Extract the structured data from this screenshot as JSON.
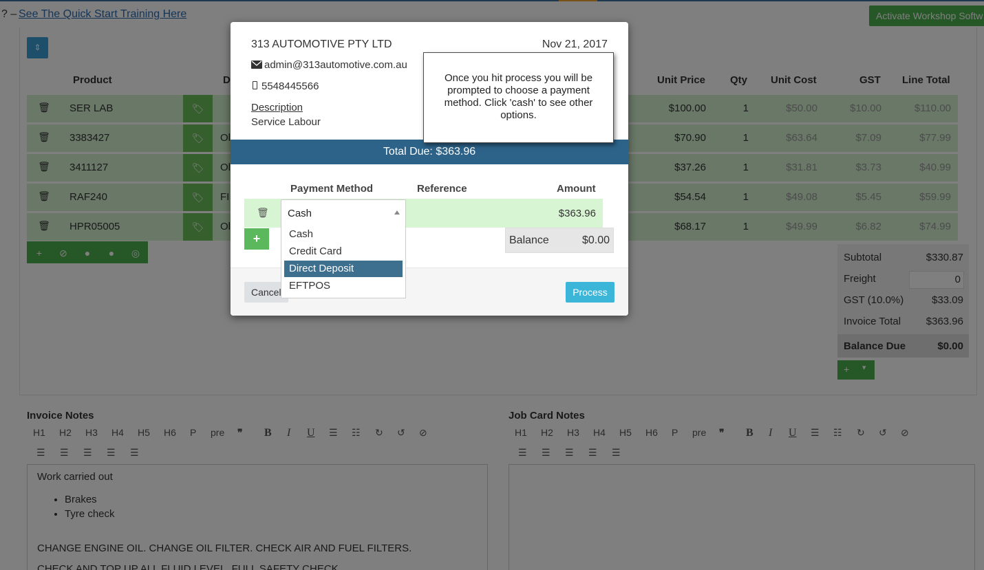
{
  "topbar": {
    "prefix": "? –",
    "training_link": "See The Quick Start Training Here",
    "activate_button": "Activate Workshop Softw"
  },
  "table": {
    "headers": [
      "Product",
      "D",
      "Unit Price",
      "Qty",
      "Unit Cost",
      "GST",
      "Line Total"
    ],
    "rows": [
      {
        "code": "SER LAB",
        "desc": "",
        "unit_price": "$100.00",
        "qty": "1",
        "unit_cost": "$50.00",
        "gst": "$10.00",
        "line_total": "$110.00"
      },
      {
        "code": "3383427",
        "desc": "Ol",
        "unit_price": "$70.90",
        "qty": "1",
        "unit_cost": "$63.64",
        "gst": "$7.09",
        "line_total": "$77.99"
      },
      {
        "code": "3411127",
        "desc": "Ol",
        "unit_price": "$37.26",
        "qty": "1",
        "unit_cost": "$31.81",
        "gst": "$3.73",
        "line_total": "$40.99"
      },
      {
        "code": "RAF240",
        "desc": "FI",
        "unit_price": "$54.54",
        "qty": "1",
        "unit_cost": "$49.08",
        "gst": "$5.45",
        "line_total": "$59.99"
      },
      {
        "code": "HPR05005",
        "desc": "Ol",
        "unit_price": "$68.17",
        "qty": "1",
        "unit_cost": "$49.99",
        "gst": "$6.82",
        "line_total": "$74.99"
      }
    ]
  },
  "totals": {
    "subtotal_label": "Subtotal",
    "subtotal": "$330.87",
    "freight_label": "Freight",
    "freight": "0",
    "gst_label": "GST (10.0%)",
    "gst": "$33.09",
    "invoice_total_label": "Invoice Total",
    "invoice_total": "$363.96",
    "balance_due_label": "Balance Due",
    "balance_due": "$0.00"
  },
  "editor_tools": [
    "H1",
    "H2",
    "H3",
    "H4",
    "H5",
    "H6",
    "P",
    "pre",
    "❞",
    "B",
    "I",
    "U"
  ],
  "invoice_notes": {
    "title": "Invoice Notes",
    "line1": "Work carried out",
    "bullets": [
      "Brakes",
      "Tyre check"
    ],
    "line2": "CHANGE ENGINE OIL. CHANGE OIL FILTER. CHECK AIR AND FUEL FILTERS.",
    "line3": "CHECK AND TOP UP ALL FLUID LEVEL. FULL SAFETY CHECK."
  },
  "job_card_notes": {
    "title": "Job Card Notes"
  },
  "modal": {
    "company": "313 AUTOMOTIVE PTY LTD",
    "date": "Nov 21, 2017",
    "email": "admin@313automotive.com.au",
    "phone": "5548445566",
    "description_label": "Description",
    "description": "Service Labour",
    "total_due": "Total Due: $363.96",
    "headers": {
      "payment_method": "Payment Method",
      "reference": "Reference",
      "amount": "Amount"
    },
    "payment": {
      "method": "Cash",
      "amount": "$363.96"
    },
    "options": [
      "Cash",
      "Credit Card",
      "Direct Deposit",
      "EFTPOS"
    ],
    "selected_option": "Direct Deposit",
    "balance_label": "Balance",
    "balance": "$0.00",
    "cancel": "Cancel",
    "process": "Process"
  },
  "tooltip": "Once you hit process you will be prompted to choose a payment method. Click 'cash' to see other options."
}
